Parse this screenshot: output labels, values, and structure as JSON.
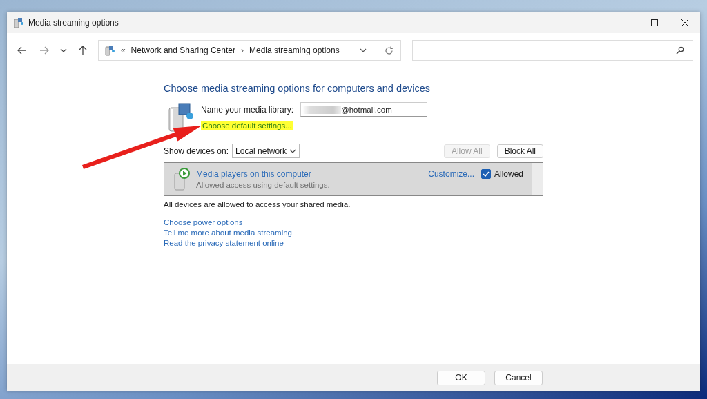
{
  "window": {
    "title": "Media streaming options"
  },
  "address": {
    "overflow": "«",
    "separator": "›",
    "crumbs": [
      "Network and Sharing Center",
      "Media streaming options"
    ]
  },
  "heading": "Choose media streaming options for computers and devices",
  "library": {
    "label": "Name your media library:",
    "value": "@hotmail.com",
    "redacted": true
  },
  "default_settings_link": {
    "label": "Choose default settings...",
    "highlighted": true
  },
  "annotation_arrow": true,
  "show_devices": {
    "label": "Show devices on:",
    "value": "Local network"
  },
  "list_buttons": [
    {
      "label": "Allow All",
      "disabled": true
    },
    {
      "label": "Block All",
      "disabled": false
    }
  ],
  "devices": [
    {
      "name": "Media players on this computer",
      "status": "Allowed access using default settings.",
      "customize": "Customize...",
      "allowed_label": "Allowed",
      "checked": true
    }
  ],
  "summary": "All devices are allowed to access your shared media.",
  "links": [
    "Choose power options",
    "Tell me more about media streaming",
    "Read the privacy statement online"
  ],
  "dialog_buttons": [
    {
      "label": "OK"
    },
    {
      "label": "Cancel"
    }
  ]
}
